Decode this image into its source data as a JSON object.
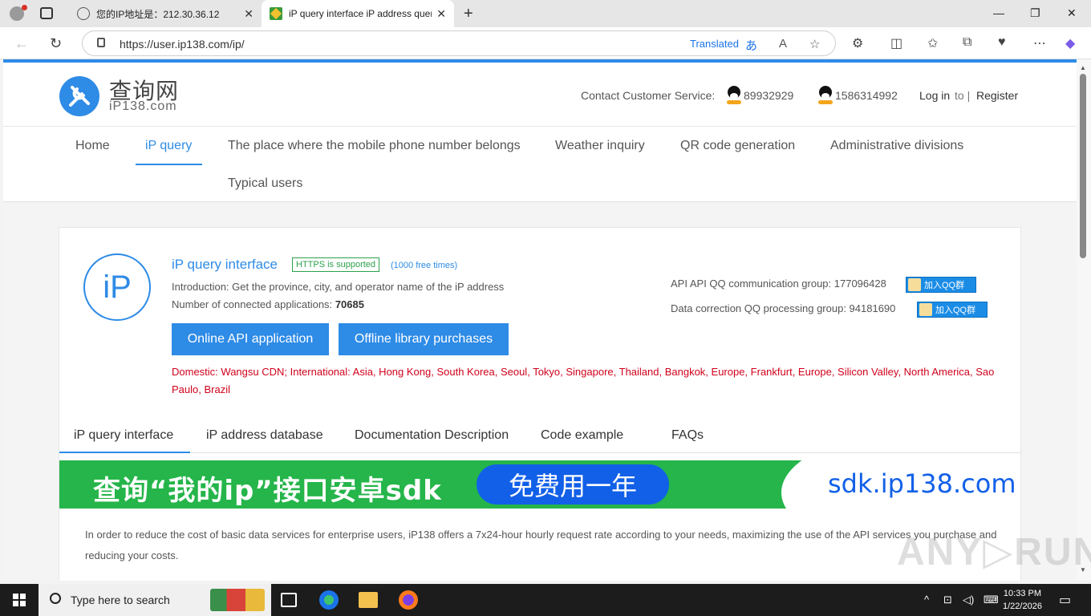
{
  "browser": {
    "tabs": [
      {
        "title": "您的IP地址是：212.30.36.12",
        "active": false
      },
      {
        "title": "iP query interface iP address quer",
        "active": true
      }
    ],
    "url": "https://user.ip138.com/ip/",
    "translated_label": "Translated"
  },
  "header": {
    "logo_cn": "查询网",
    "logo_en": "iP138.com",
    "contact_label": "Contact Customer Service:",
    "qq_numbers": [
      "89932929",
      "1586314992"
    ],
    "login": "Log in",
    "to": "to |",
    "register": "Register"
  },
  "nav": {
    "items": [
      "Home",
      "iP query",
      "The place where the mobile phone number belongs",
      "Weather inquiry",
      "QR code generation",
      "Administrative divisions",
      "Typical users"
    ],
    "active_index": 1
  },
  "card": {
    "icon_text": "iP",
    "title": "iP query interface",
    "https_badge": "HTTPS is supported",
    "free_times": "(1000 free times)",
    "intro": "Introduction: Get the province, city, and operator name of the iP address",
    "apps_label": "Number of connected applications:",
    "apps_count": "70685",
    "btn_online": "Online API application",
    "btn_offline": "Offline library purchases",
    "group_api": "API API QQ communication group: 177096428",
    "group_data": "Data correction QQ processing group: 94181690",
    "join_label": "加入QQ群",
    "servers": "Domestic: Wangsu CDN; International: Asia, Hong Kong, South Korea, Seoul, Tokyo, Singapore, Thailand, Bangkok, Europe, Frankfurt, Europe, Silicon Valley, North America, Sao Paulo, Brazil"
  },
  "content_tabs": [
    "iP query interface",
    "iP address database",
    "Documentation Description",
    "Code example",
    "FAQs"
  ],
  "banner": {
    "text": "查询“我的ip”接口安卓sdk",
    "pill": "免费用一年",
    "url": "sdk.ip138.com"
  },
  "description": "In order to reduce the cost of basic data services for enterprise users, iP138 offers a 7x24-hour hourly request rate according to your needs, maximizing the use of the API services you purchase and reducing your costs.",
  "taskbar": {
    "search_placeholder": "Type here to search",
    "time": "10:33 PM",
    "date": "1/22/2026"
  },
  "colors": {
    "accent": "#2e8be6",
    "red_text": "#d0021b",
    "https_green": "#2ca14b",
    "banner_green": "#25b54a"
  }
}
